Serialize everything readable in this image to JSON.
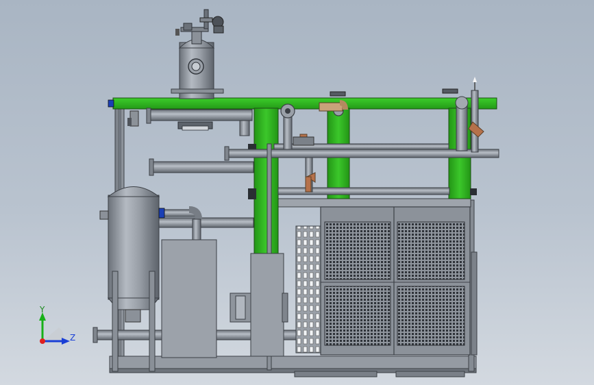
{
  "viewport": {
    "background_top": "#a9b5c3",
    "background_bottom": "#d3d9e0"
  },
  "model": {
    "frame_green": "#2fb521",
    "steel_gray": "#9aa0a8",
    "dark_gray": "#4a4e55",
    "valve_copper": "#b5714a",
    "pipe_fitting_tan": "#c8a27a"
  },
  "triad": {
    "x_label": "",
    "y_label": "Y",
    "z_label": "Z",
    "x_color": "#e02020",
    "y_color": "#18b018",
    "z_color": "#1a3fd6"
  }
}
